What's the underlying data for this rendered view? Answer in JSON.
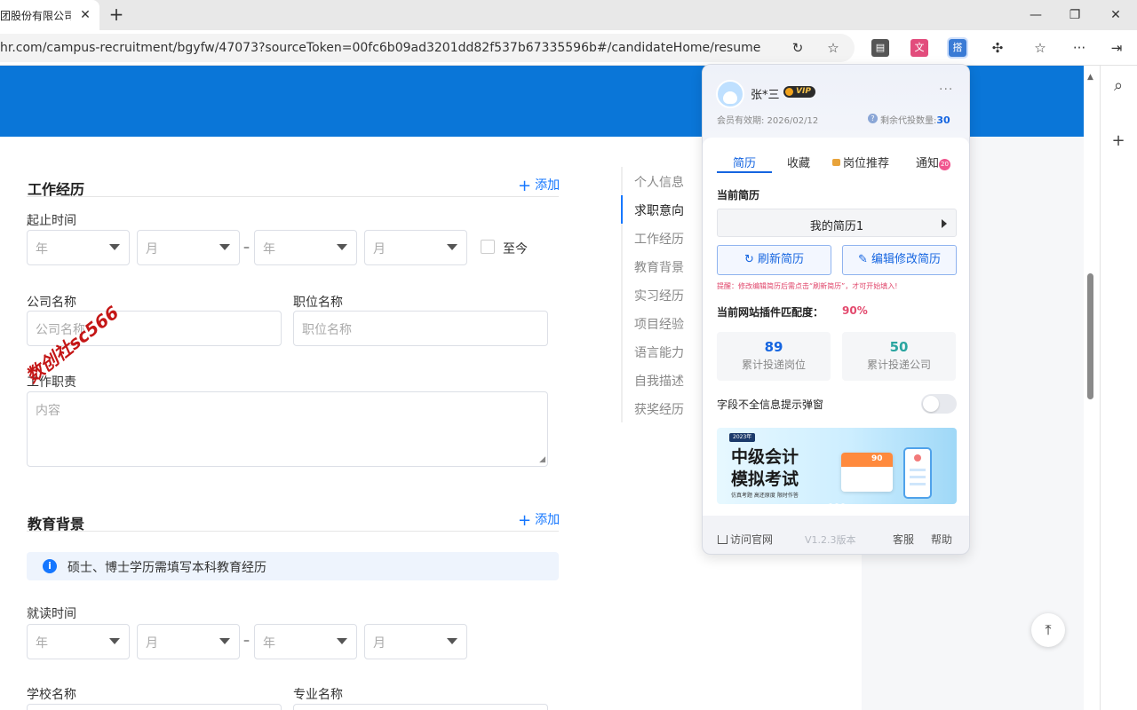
{
  "browser": {
    "tab_title": "团股份有限公司",
    "tab_close": "✕",
    "new_tab": "+",
    "url": "hr.com/campus-recruitment/bgyfw/47073?sourceToken=00fc6b09ad3201dd82f537b67335596b#/candidateHome/resume",
    "ext_icons": [
      "badge-icon",
      "puzzle-card-icon",
      "recruit-ext-icon"
    ]
  },
  "page": {
    "work": {
      "title": "工作经历",
      "add_label": "添加",
      "period_label": "起止时间",
      "year_ph": "年",
      "month_ph": "月",
      "dash": "–",
      "until_now": "至今",
      "company_label": "公司名称",
      "company_ph": "公司名称",
      "position_label": "职位名称",
      "position_ph": "职位名称",
      "duty_label": "工作职责",
      "duty_ph": "内容"
    },
    "edu": {
      "title": "教育背景",
      "add_label": "添加",
      "notice": "硕士、博士学历需填写本科教育经历",
      "period_label": "就读时间",
      "year_ph": "年",
      "month_ph": "月",
      "dash": "–",
      "school_label": "学校名称",
      "major_label": "专业名称"
    },
    "anchors": [
      {
        "label": "个人信息",
        "active": false
      },
      {
        "label": "求职意向",
        "active": true
      },
      {
        "label": "工作经历",
        "active": false
      },
      {
        "label": "教育背景",
        "active": false
      },
      {
        "label": "实习经历",
        "active": false
      },
      {
        "label": "项目经验",
        "active": false
      },
      {
        "label": "语言能力",
        "active": false
      },
      {
        "label": "自我描述",
        "active": false
      },
      {
        "label": "获奖经历",
        "active": false
      }
    ],
    "watermark": "数创社sc566"
  },
  "popup": {
    "user_name": "张*三",
    "vip": "VIP",
    "more": "···",
    "expire": "会员有效期: 2026/02/12",
    "quota_label": "剩余代投数量:",
    "quota_value": "30",
    "tabs": {
      "resume": "简历",
      "favorites": "收藏",
      "recommend": "岗位推荐",
      "notify": "通知",
      "notify_badge": "20"
    },
    "current_resume_label": "当前简历",
    "current_resume_value": "我的简历1",
    "refresh_button": "刷新简历",
    "edit_button": "编辑修改简历",
    "tip": "提醒：修改编辑简历后需点击“刷新简历”，才可开始填入!",
    "match_label": "当前网站插件匹配度：",
    "match_value": "90%",
    "stats": [
      {
        "value": "89",
        "label": "累计投递岗位",
        "color": "#1565e0"
      },
      {
        "value": "50",
        "label": "累计投递公司",
        "color": "#2aa5a0"
      }
    ],
    "toggle_label": "字段不全信息提示弹窗",
    "toggle_on": false,
    "banner": {
      "year": "2023年",
      "title1": "中级会计",
      "title2": "模拟考试",
      "sub": "仿真考题  高还原度  限时作答",
      "card_num": "90"
    },
    "footer": {
      "visit": "访问官网",
      "version": "V1.2.3版本",
      "service": "客服",
      "help": "帮助"
    }
  },
  "colors": {
    "brand_blue": "#0a76d8",
    "link_blue": "#1677ff",
    "popup_blue": "#1565e0",
    "alert_pink": "#e34a6e"
  }
}
